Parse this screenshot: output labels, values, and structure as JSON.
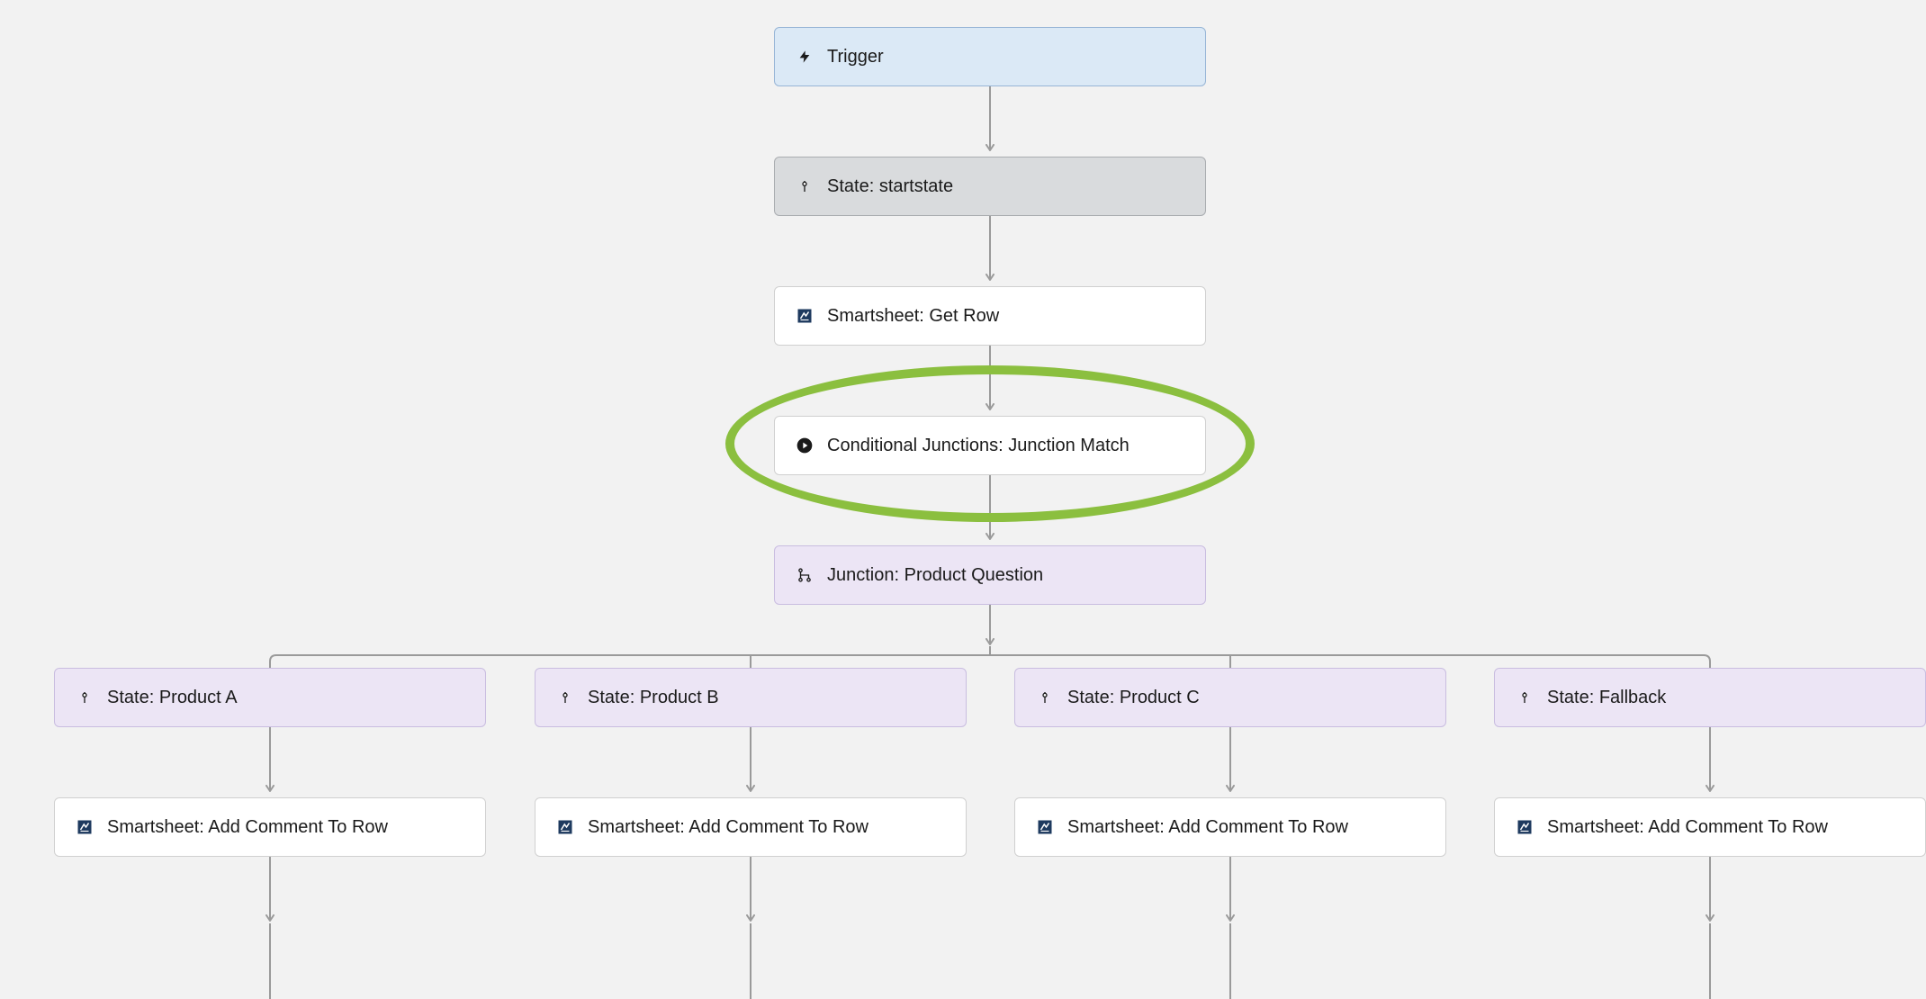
{
  "nodes": {
    "trigger": {
      "label": "Trigger"
    },
    "startstate": {
      "label": "State: startstate"
    },
    "getrow": {
      "label": "Smartsheet: Get Row"
    },
    "junctionmatch": {
      "label": "Conditional Junctions: Junction Match"
    },
    "productquestion": {
      "label": "Junction: Product Question"
    },
    "productA": {
      "label": "State: Product A"
    },
    "productB": {
      "label": "State: Product B"
    },
    "productC": {
      "label": "State: Product C"
    },
    "fallback": {
      "label": "State: Fallback"
    },
    "addcommentA": {
      "label": "Smartsheet: Add Comment To Row"
    },
    "addcommentB": {
      "label": "Smartsheet: Add Comment To Row"
    },
    "addcommentC": {
      "label": "Smartsheet: Add Comment To Row"
    },
    "addcommentF": {
      "label": "Smartsheet: Add Comment To Row"
    }
  },
  "colors": {
    "trigger_bg": "#dbe9f6",
    "state_bg": "#d9dbdd",
    "action_bg": "#ffffff",
    "junction_bg": "#ece5f5",
    "highlight": "#8bbf3f",
    "arrow": "#9a9a9a"
  }
}
